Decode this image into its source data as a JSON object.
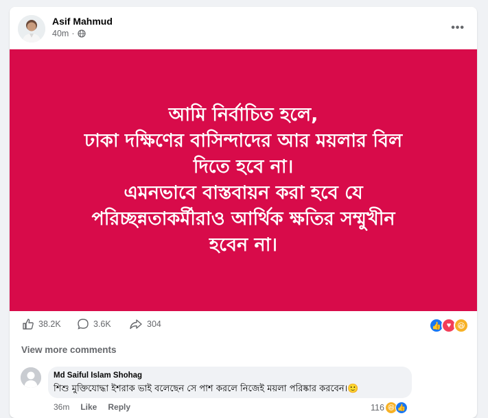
{
  "post": {
    "author": "Asif Mahmud",
    "time": "40m",
    "more_label": "•••",
    "banner_lines": [
      "আমি নির্বাচিত হলে,",
      "ঢাকা দক্ষিণের বাসিন্দাদের আর ময়লার বিল",
      "দিতে হবে না।",
      "এমনভাবে বাস্তবায়ন করা হবে যে",
      "পরিচ্ছন্নতাকর্মীরাও আর্থিক ক্ষতির সম্মুখীন",
      "হবেন না।"
    ],
    "banner_color": "#d80b4a"
  },
  "stats": {
    "likes": "38.2K",
    "comments": "3.6K",
    "shares": "304"
  },
  "view_more": "View more comments",
  "comment": {
    "author": "Md Saiful Islam Shohag",
    "text": "শিশু মুক্তিযোদ্ধা ইশরাক ভাই বলেছেন সে পাশ করলে নিজেই ময়লা পরিষ্কার করবেন।",
    "time": "36m",
    "like_label": "Like",
    "reply_label": "Reply",
    "reaction_count": "116"
  }
}
